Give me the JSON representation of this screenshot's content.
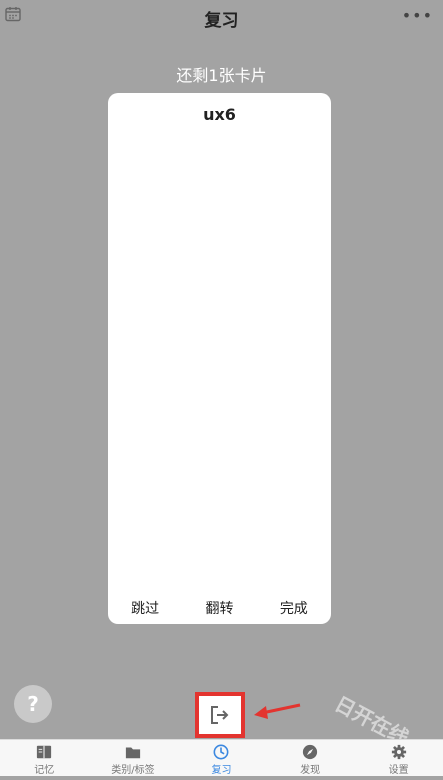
{
  "header": {
    "title": "复习",
    "more_label": "•••"
  },
  "review": {
    "remaining_text": "还剩1张卡片"
  },
  "card": {
    "word": "ux6",
    "actions": {
      "skip": "跳过",
      "flip": "翻转",
      "done": "完成"
    }
  },
  "help": {
    "label": "?"
  },
  "watermark": {
    "text": "日开在线"
  },
  "tabs": [
    {
      "label": "记忆",
      "icon": "book-icon",
      "active": false
    },
    {
      "label": "类别/标签",
      "icon": "folder-icon",
      "active": false
    },
    {
      "label": "复习",
      "icon": "clock-icon",
      "active": true
    },
    {
      "label": "发现",
      "icon": "compass-icon",
      "active": false
    },
    {
      "label": "设置",
      "icon": "gear-icon",
      "active": false
    }
  ],
  "colors": {
    "accent": "#3b88e0",
    "highlight": "#e3342f",
    "background": "#a3a3a3"
  }
}
